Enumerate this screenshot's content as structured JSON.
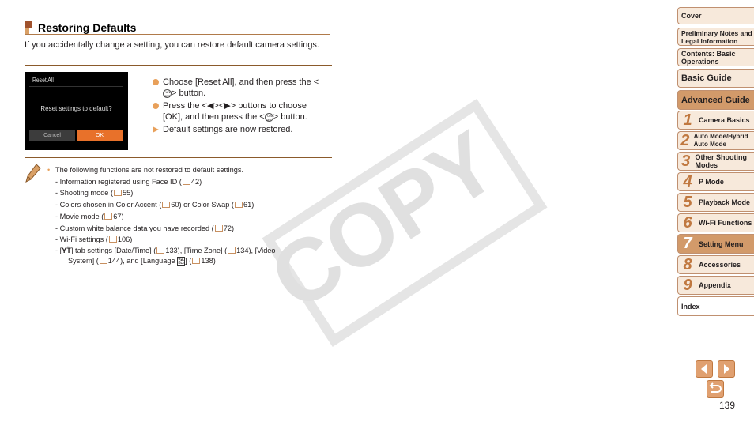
{
  "section": {
    "title": "Restoring Defaults",
    "intro": "If you accidentally change a setting, you can restore default camera settings."
  },
  "camera_screen": {
    "header": "Reset All",
    "question": "Reset settings to default?",
    "cancel_label": "Cancel",
    "ok_label": "OK"
  },
  "steps": [
    {
      "type": "bullet",
      "text_before": "Choose [Reset All], and then press the <",
      "button_icon": "func-set",
      "text_after": "> button."
    },
    {
      "type": "bullet",
      "text_before": "Press the <◀><▶> buttons to choose [OK], and then press the <",
      "button_icon": "func-set",
      "text_after": "> button."
    },
    {
      "type": "result",
      "text": "Default settings are now restored."
    }
  ],
  "note": {
    "lead": "The following functions are not restored to default settings.",
    "items": [
      {
        "text": "- Information registered using Face ID (",
        "page": "42",
        "tail": ")"
      },
      {
        "text": "- Shooting mode (",
        "page": "55",
        "tail": ")"
      },
      {
        "text": "- Colors chosen in Color Accent (",
        "page": "60",
        "mid": ") or Color Swap (",
        "page2": "61",
        "tail": ")"
      },
      {
        "text": "- Movie mode (",
        "page": "67",
        "tail": ")"
      },
      {
        "text": "- Custom white balance data you have recorded (",
        "page": "72",
        "tail": ")"
      },
      {
        "text": "- Wi-Fi settings (",
        "page": "106",
        "tail": ")"
      }
    ],
    "last_item": {
      "line1_a": "- [",
      "tab_icon": "ŸŤ",
      "line1_b": "] tab settings [Date/Time] (",
      "p1": "133",
      "line1_c": "), [Time Zone] (",
      "p2": "134",
      "line1_d": "), [Video",
      "line2_a": "System] (",
      "p3": "144",
      "line2_b": "), and [Language ",
      "lang_icon": "語",
      "line2_c": "] (",
      "p4": "138",
      "line2_d": ")"
    }
  },
  "watermark": "COPY",
  "sidebar": {
    "items": [
      {
        "label": "Cover"
      },
      {
        "label": "Preliminary Notes and Legal Information"
      },
      {
        "label": "Contents: Basic Operations"
      },
      {
        "label": "Basic Guide"
      },
      {
        "label": "Advanced Guide",
        "active": true
      }
    ],
    "chapters": [
      {
        "num": "1",
        "label": "Camera Basics"
      },
      {
        "num": "2",
        "label": "Auto Mode/Hybrid Auto Mode"
      },
      {
        "num": "3",
        "label": "Other Shooting Modes"
      },
      {
        "num": "4",
        "label": "P Mode"
      },
      {
        "num": "5",
        "label": "Playback Mode"
      },
      {
        "num": "6",
        "label": "Wi-Fi Functions"
      },
      {
        "num": "7",
        "label": "Setting Menu",
        "active": true
      },
      {
        "num": "8",
        "label": "Accessories"
      },
      {
        "num": "9",
        "label": "Appendix"
      }
    ],
    "index_label": "Index"
  },
  "page_number": "139",
  "colors": {
    "accent": "#d29a6a",
    "rule": "#8b5a2b",
    "ok_button": "#e8712a",
    "bullet": "#e8a05a"
  }
}
